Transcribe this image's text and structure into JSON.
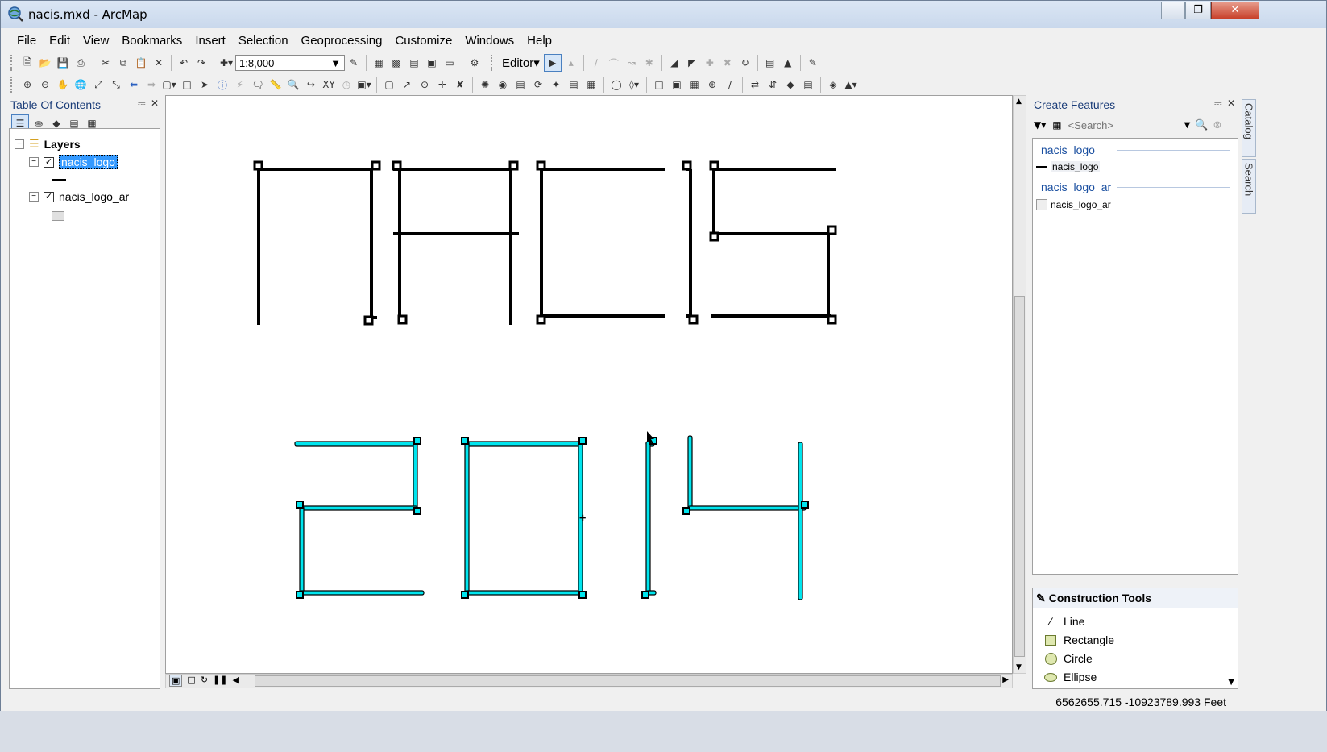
{
  "window": {
    "title": "nacis.mxd - ArcMap"
  },
  "menu": [
    "File",
    "Edit",
    "View",
    "Bookmarks",
    "Insert",
    "Selection",
    "Geoprocessing",
    "Customize",
    "Windows",
    "Help"
  ],
  "toolbar": {
    "scale": "1:8,000",
    "editor_label": "Editor"
  },
  "toc": {
    "title": "Table Of Contents",
    "root_label": "Layers",
    "layers": [
      {
        "name": "nacis_logo",
        "checked": true,
        "selected": true
      },
      {
        "name": "nacis_logo_ar",
        "checked": true,
        "selected": false
      }
    ]
  },
  "create_features": {
    "title": "Create Features",
    "search_placeholder": "<Search>",
    "groups": [
      {
        "name": "nacis_logo",
        "template": "nacis_logo"
      },
      {
        "name": "nacis_logo_ar",
        "template": "nacis_logo_ar"
      }
    ]
  },
  "construction_tools": {
    "title": "Construction Tools",
    "items": [
      "Line",
      "Rectangle",
      "Circle",
      "Ellipse"
    ]
  },
  "side_tabs": [
    "Catalog",
    "Search"
  ],
  "status": {
    "coordinates": "6562655.715  -10923789.993 Feet"
  },
  "colors": {
    "line_feature": "#000000",
    "polygon_feature": "#00e5ee",
    "selection": "#3399ff",
    "panel_title": "#1a3c78"
  }
}
